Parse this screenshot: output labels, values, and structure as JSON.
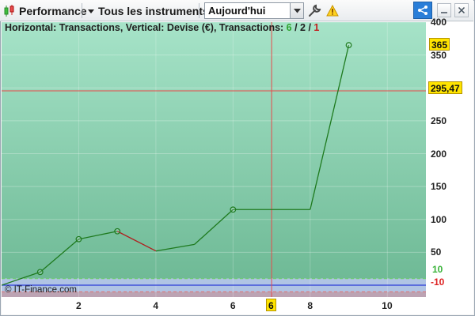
{
  "toolbar": {
    "performance_label": "Performance",
    "instruments_label": "Tous les instruments",
    "period_value": "Aujourd'hui"
  },
  "legend": {
    "prefix": "Horizontal: Transactions, Vertical: Devise (€), Transactions: ",
    "count_green": "6",
    "sep1": " / ",
    "count_black": "2",
    "sep2": " / ",
    "count_red": "1"
  },
  "watermark": "© IT-Finance.com",
  "markers": {
    "current_value": "365",
    "cursor_value": "295,47",
    "cursor_x": "6",
    "upper_band": "10",
    "lower_band": "-10"
  },
  "colors": {
    "plot_top": "#a6e3c8",
    "plot_bottom": "#6fba96",
    "band": "#b0c4e4",
    "below_band": "#bca3b3",
    "line_up": "#1e7a1e",
    "line_down": "#b01e1e",
    "cursor": "#e84a4a",
    "zero_line": "#2b3bd6",
    "badge_yellow": "#ffe400"
  },
  "chart_data": {
    "type": "line",
    "x": [
      0,
      1,
      2,
      3,
      4,
      5,
      6,
      7,
      8,
      9
    ],
    "values": [
      0,
      20,
      70,
      82,
      52,
      62,
      115,
      115,
      115,
      365
    ],
    "markers_at": [
      1,
      2,
      3,
      6,
      9
    ],
    "down_segments": [
      [
        3,
        4
      ]
    ],
    "xlim": [
      0,
      11
    ],
    "ylim": [
      -18,
      400
    ],
    "x_ticks": [
      "2",
      "4",
      "6",
      "8",
      "10"
    ],
    "y_ticks": [
      "50",
      "100",
      "150",
      "200",
      "250",
      "300",
      "350",
      "400"
    ],
    "cursor": {
      "x": 7,
      "y": 295.47
    },
    "band": [
      -10,
      10
    ]
  }
}
